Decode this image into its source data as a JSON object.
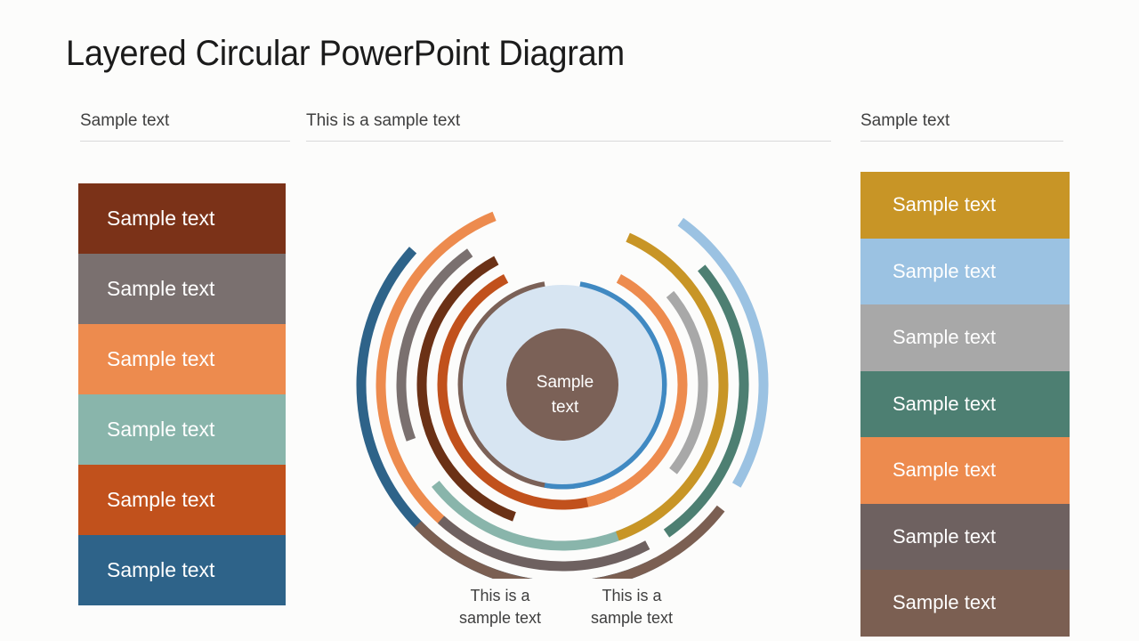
{
  "slide": {
    "title": "Layered Circular PowerPoint Diagram",
    "background_color": "#fcfcfb"
  },
  "headers": {
    "left": "Sample text",
    "center": "This is a sample text",
    "right": "Sample text"
  },
  "left_column": {
    "items": [
      {
        "label": "Sample text",
        "color": "#7b3218"
      },
      {
        "label": "Sample text",
        "color": "#7a706f"
      },
      {
        "label": "Sample text",
        "color": "#ed8b4e"
      },
      {
        "label": "Sample text",
        "color": "#89b5ab"
      },
      {
        "label": "Sample text",
        "color": "#c1511c"
      },
      {
        "label": "Sample text",
        "color": "#2e6389"
      }
    ]
  },
  "right_column": {
    "items": [
      {
        "label": "Sample text",
        "color": "#c89526"
      },
      {
        "label": "Sample text",
        "color": "#9bc2e2"
      },
      {
        "label": "Sample text",
        "color": "#a8a8a8"
      },
      {
        "label": "Sample text",
        "color": "#4d7f72"
      },
      {
        "label": "Sample text",
        "color": "#ed8b4e"
      },
      {
        "label": "Sample text",
        "color": "#6e6160"
      },
      {
        "label": "Sample text",
        "color": "#7b5f52"
      }
    ]
  },
  "diagram": {
    "center_label": "Sample\ntext",
    "center_label_line1": "Sample",
    "center_label_line2": "text",
    "center_circle_color": "#7b6157",
    "halo_ring_color": "#d7e5f2",
    "left_arcs": [
      {
        "color": "#7b6157",
        "ring": 1
      },
      {
        "color": "#c1511c",
        "ring": 2
      },
      {
        "color": "#6b3116",
        "ring": 3
      },
      {
        "color": "#7a706f",
        "ring": 4
      },
      {
        "color": "#89b5ab",
        "ring": 4
      },
      {
        "color": "#ed8b4e",
        "ring": 5
      },
      {
        "color": "#2e6389",
        "ring": 6
      }
    ],
    "right_arcs": [
      {
        "color": "#4089c2",
        "ring": 1
      },
      {
        "color": "#ed8b4e",
        "ring": 2
      },
      {
        "color": "#a8a8a8",
        "ring": 3
      },
      {
        "color": "#c89526",
        "ring": 4
      },
      {
        "color": "#4d7f72",
        "ring": 5
      },
      {
        "color": "#6e6160",
        "ring": 5
      },
      {
        "color": "#9bc2e2",
        "ring": 6
      },
      {
        "color": "#7b5f52",
        "ring": 6
      }
    ]
  },
  "captions": {
    "left": "This is a\nsample text",
    "left_line1": "This is a",
    "left_line2": "sample text",
    "right": "This is a\nsample text",
    "right_line1": "This is a",
    "right_line2": "sample text"
  }
}
